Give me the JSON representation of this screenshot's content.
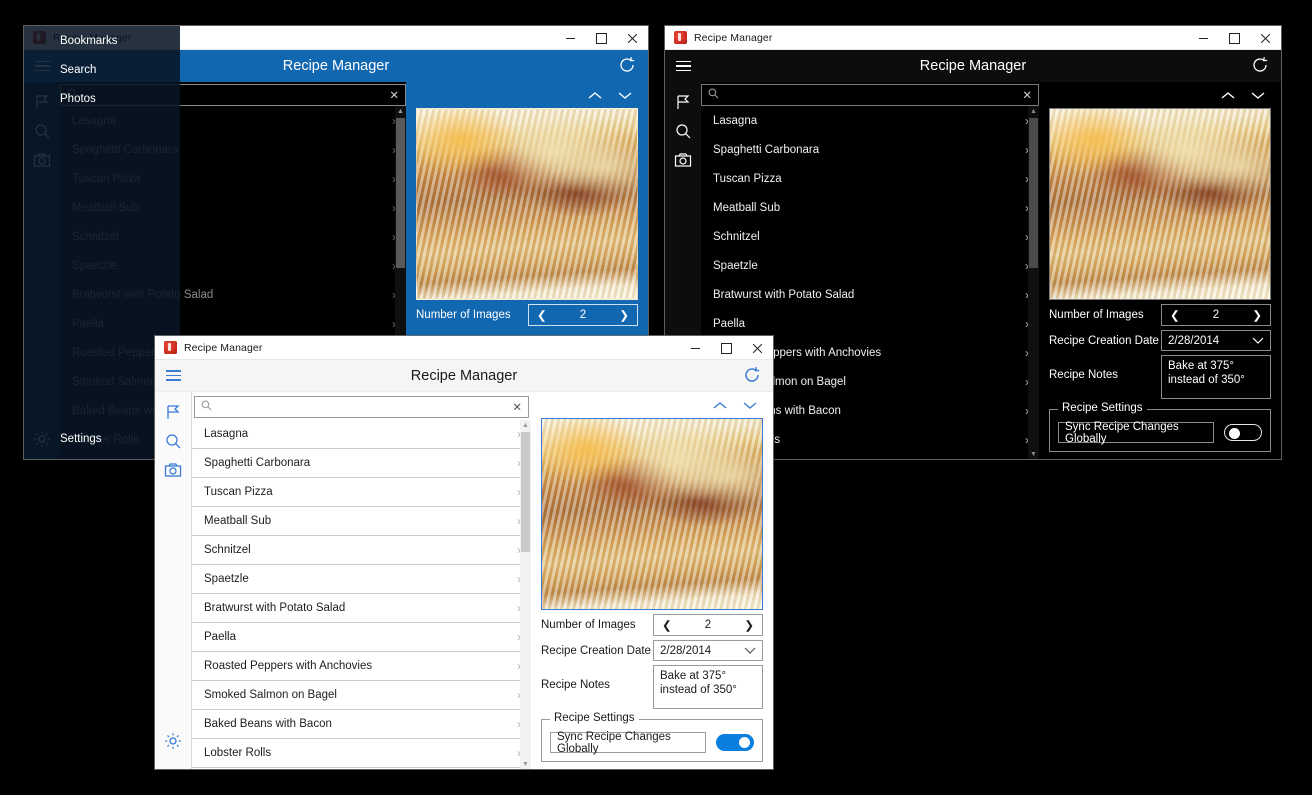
{
  "app": {
    "name": "Recipe Manager",
    "titlebar_title": "Recipe Manager",
    "header_title": "Recipe Manager",
    "accent_blue": "#1267b1",
    "light_accent": "#3a7bd5",
    "toggle_on_color": "#0b7fe0"
  },
  "window_controls": {
    "minimize": "–",
    "maximize": "□",
    "close": "✕"
  },
  "icons": {
    "hamburger": "hamburger-menu-icon",
    "refresh": "refresh-icon",
    "flag": "bookmarks-flag-icon",
    "search": "search-magnifier-icon",
    "camera": "photos-camera-icon",
    "gear": "settings-gear-icon",
    "chevron_up": "chevron-up-icon",
    "chevron_down": "chevron-down-icon",
    "chevron_right": "chevron-right-icon",
    "chevron_left": "chevron-left-icon",
    "clear": "clear-x-icon"
  },
  "nav_flyout": {
    "items": [
      {
        "label": "Bookmarks",
        "icon": "flag"
      },
      {
        "label": "Search",
        "icon": "search"
      },
      {
        "label": "Photos",
        "icon": "camera"
      },
      {
        "label": "Settings",
        "icon": "gear"
      }
    ]
  },
  "search": {
    "value": "",
    "placeholder": "",
    "clear_label": "✕"
  },
  "recipes": [
    "Lasagna",
    "Spaghetti Carbonara",
    "Tuscan Pizza",
    "Meatball Sub",
    "Schnitzel",
    "Spaetzle",
    "Bratwurst with Potato Salad",
    "Paella",
    "Roasted Peppers with Anchovies",
    "Smoked Salmon on Bagel",
    "Baked Beans with Bacon",
    "Lobster Rolls"
  ],
  "detail": {
    "number_of_images_label": "Number of Images",
    "number_of_images_value": "2",
    "creation_date_label": "Recipe Creation Date",
    "creation_date_value": "2/28/2014",
    "notes_label": "Recipe Notes",
    "notes_value": "Bake at 375° instead of 350°",
    "settings_legend": "Recipe Settings",
    "sync_label": "Sync Recipe Changes Globally",
    "photo_alt": "lasagna-photo"
  },
  "windows": [
    {
      "id": "win1",
      "theme": "blue",
      "nav_flyout_open": true,
      "sync_toggle_on": false
    },
    {
      "id": "win2",
      "theme": "dark",
      "nav_flyout_open": false,
      "sync_toggle_on": false
    },
    {
      "id": "win3",
      "theme": "light",
      "nav_flyout_open": false,
      "sync_toggle_on": true
    }
  ]
}
